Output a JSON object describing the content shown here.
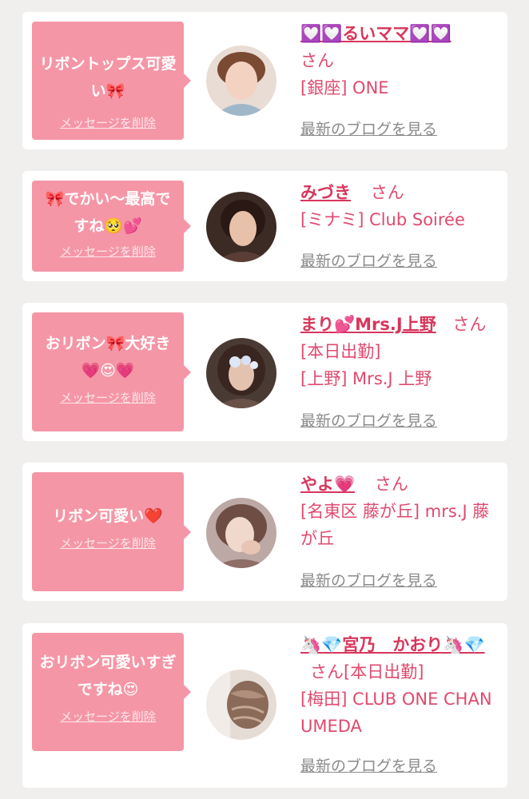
{
  "messages": [
    {
      "comment": "リボントップス可愛い🎀",
      "delete_label": "メッセージを削除",
      "cast_name": "💟💟るいママ💟💟",
      "honorific": "さん",
      "shop": "[銀座] ONE",
      "blog_label": "最新のブログを見る"
    },
    {
      "comment": "🎀でかい〜最高ですね🥺💕",
      "delete_label": "メッセージを削除",
      "cast_name": "みづき",
      "honorific": "さん",
      "shop": "[ミナミ] Club Soirée",
      "blog_label": "最新のブログを見る"
    },
    {
      "comment": "おリボン🎀大好き💗😍💗",
      "delete_label": "メッセージを削除",
      "cast_name": "まり💕Mrs.J上野",
      "honorific": "さん[本日出勤]",
      "shop": "[上野] Mrs.J 上野",
      "blog_label": "最新のブログを見る"
    },
    {
      "comment": "リボン可愛い❤️",
      "delete_label": "メッセージを削除",
      "cast_name": "やよ💗",
      "honorific": "さん",
      "shop": "[名東区 藤が丘] mrs.J 藤が丘",
      "blog_label": "最新のブログを見る"
    },
    {
      "comment": "おリボン可愛いすぎですね😍",
      "delete_label": "メッセージを削除",
      "cast_name": "🦄💎宮乃　かおり🦄💎",
      "honorific": "さん[本日出勤]",
      "shop": "[梅田] CLUB ONE CHAN UMEDA",
      "blog_label": "最新のブログを見る"
    }
  ],
  "colors": {
    "bubble": "#f596a6",
    "accent": "#d8365c",
    "text_pink": "#e04a6e",
    "link_gray": "#8a8a8a",
    "background": "#f1eeee"
  }
}
